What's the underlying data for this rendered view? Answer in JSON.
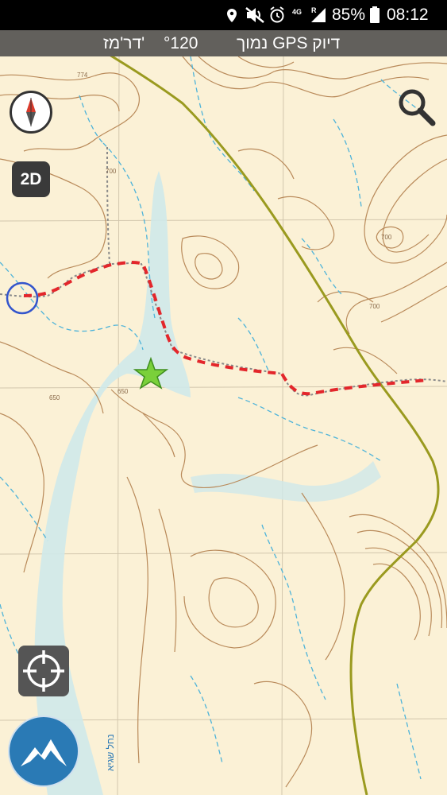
{
  "status_bar": {
    "battery": "85%",
    "time": "08:12",
    "network": "4G",
    "roaming": "R",
    "icons": [
      "location-pin-icon",
      "mute-icon",
      "alarm-icon",
      "signal-icon",
      "battery-icon"
    ]
  },
  "gps_banner": {
    "accuracy": "דיוק GPS נמוך",
    "bearing": "°120",
    "direction": "דר'מז'"
  },
  "map": {
    "view_mode": "2D",
    "contour_labels": [
      "774",
      "700",
      "700",
      "700",
      "650",
      "650"
    ],
    "stream_name": "נחל שגיא",
    "colors": {
      "paper": "#fbf1d6",
      "contour": "#b98a5a",
      "stream": "#4db3d9",
      "valley": "#cfe9ea",
      "boundary": "#9a9a1f",
      "track_red": "#e3262b",
      "track_gray": "#8a8a8a",
      "star": "#7ad03a",
      "circle": "#3355cc"
    }
  },
  "controls": {
    "compass": "compass-icon",
    "search": "search-icon",
    "locate": "crosshair-icon",
    "app_menu": "mountain-logo-icon"
  }
}
